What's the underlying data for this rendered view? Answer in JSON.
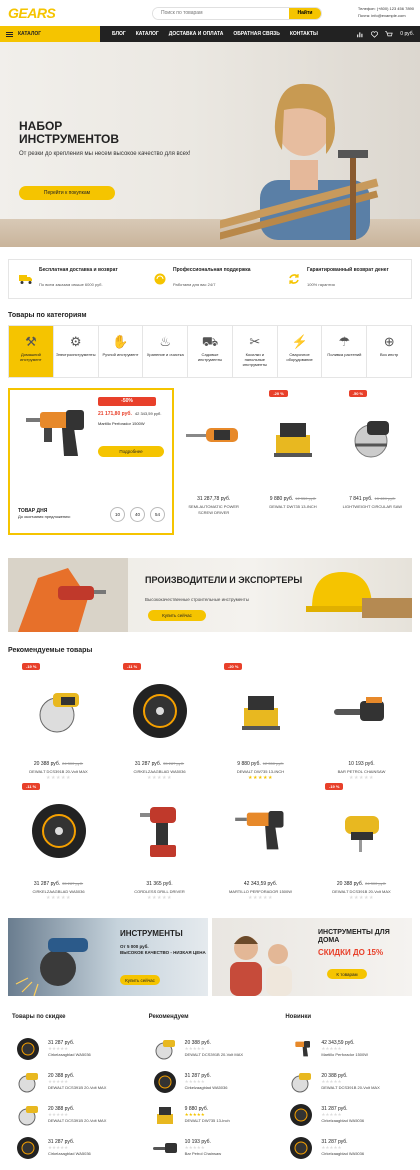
{
  "header": {
    "logo": "GEARS",
    "search_placeholder": "Поиск по товарам",
    "search_button": "Найти",
    "phone": "Телефон: (+800) 123 456 7890",
    "email": "Почта: info@example.com"
  },
  "nav": {
    "catalog": "КАТАЛОГ",
    "links": [
      "БЛОГ",
      "КАТАЛОГ",
      "ДОСТАВКА И ОПЛАТА",
      "ОБРАТНАЯ СВЯЗЬ",
      "КОНТАКТЫ"
    ],
    "cart_count": "0",
    "cart_total": "0 руб."
  },
  "hero": {
    "title": "НАБОР ИНСТРУМЕНТОВ",
    "subtitle": "От резки до крепления мы несем высокое качество для всех!",
    "button": "Перейти к покупкам"
  },
  "features": [
    {
      "title": "Бесплатная доставка и возврат",
      "text": "По всем заказам свыше 6000 руб.",
      "icon": "truck-icon"
    },
    {
      "title": "Профессиональная поддержка",
      "text": "Работаем для вас 24/7",
      "icon": "support-icon"
    },
    {
      "title": "Гарантированный возврат денег",
      "text": "100% гарантия",
      "icon": "refund-icon"
    }
  ],
  "categories_title": "Товары по категориям",
  "categories": [
    "Домашний инструмент",
    "Электроинструменты",
    "Ручной инструмент",
    "Хранение и очистка",
    "Садовые инструменты",
    "Косилки и напольные инструменты",
    "Сварочное оборудование",
    "Поливка растений",
    "Воз инстр"
  ],
  "deal": {
    "badge": "-50%",
    "price": "21 171,80 руб.",
    "old_price": "42 343,59 руб.",
    "name": "Martillo Perforador 1500W",
    "button": "Подробнее",
    "label": "ТОВАР ДНЯ",
    "sub": "До окончания предложения:",
    "timer": [
      "10",
      "40",
      "54"
    ]
  },
  "deal_products": [
    {
      "badge": "",
      "price": "31 287,78 руб.",
      "old": "",
      "name": "SEMI-AUTOMATIC POWER SCREW DRIVER"
    },
    {
      "badge": "-20 %",
      "price": "9 880 руб.",
      "old": "12 350 руб.",
      "name": "DEWALT DW735 13-INCH"
    },
    {
      "badge": "-50 %",
      "price": "7 841 руб.",
      "old": "15 424 руб.",
      "name": "LIGHTWEIGHT CIRCULAR SAW"
    }
  ],
  "banner": {
    "title": "ПРОИЗВОДИТЕЛИ И ЭКСПОРТЕРЫ",
    "text": "Высококачественные строительные инструменты",
    "button": "Купить сейчас"
  },
  "recommended_title": "Рекомендуемые товары",
  "recommended": [
    {
      "badge": "-19 %",
      "price": "20 388 руб.",
      "old": "24 300 руб.",
      "name": "DEWALT DCS391B 20-Volt MAX",
      "rated": false
    },
    {
      "badge": "-11 %",
      "price": "31 287 руб.",
      "old": "35 287 руб.",
      "name": "CIRKELZAAGBLAD WA5036",
      "rated": false
    },
    {
      "badge": "-20 %",
      "price": "9 880 руб.",
      "old": "12 350 руб.",
      "name": "DEWALT DW735 13-INCH",
      "rated": true
    },
    {
      "badge": "",
      "price": "10 193 руб.",
      "old": "",
      "name": "BAR PETROL CHAINSAW",
      "rated": false
    },
    {
      "badge": "-11 %",
      "price": "31 287 руб.",
      "old": "35 287 руб.",
      "name": "CIRKELZAAGBLAD WA5036",
      "rated": false
    },
    {
      "badge": "",
      "price": "31 365 руб.",
      "old": "",
      "name": "CORDLESS DRILL DRIVER",
      "rated": false
    },
    {
      "badge": "",
      "price": "42 343,59 руб.",
      "old": "",
      "name": "MARTILLO PERFORADOR 1500W",
      "rated": false
    },
    {
      "badge": "-19 %",
      "price": "20 388 руб.",
      "old": "24 300 руб.",
      "name": "DEWALT DCS391B 20-Volt MAX",
      "rated": false
    }
  ],
  "promo1": {
    "title": "ИНСТРУМЕНТЫ",
    "price": "От 5 000 руб.",
    "text": "ВЫСОКОЕ КАЧЕСТВО - НИЗКАЯ ЦЕНА",
    "button": "Купить сейчас"
  },
  "promo2": {
    "title": "ИНСТРУМЕНТЫ ДЛЯ ДОМА",
    "hot": "СКИДКИ ДО 15%",
    "button": "К товарам"
  },
  "lists": [
    {
      "title": "Товары по скидке",
      "items": [
        {
          "price": "31 287 руб.",
          "name": "Cirkelzaagblad WA5036",
          "rated": false
        },
        {
          "price": "20 388 руб.",
          "name": "DEWALT DCS391B 20-Volt MAX",
          "rated": false
        },
        {
          "price": "20 388 руб.",
          "name": "DEWALT DCS391B 20-Volt MAX",
          "rated": false
        },
        {
          "price": "31 287 руб.",
          "name": "Cirkelzaagblad WA5036",
          "rated": false
        }
      ]
    },
    {
      "title": "Рекомендуем",
      "items": [
        {
          "price": "20 388 руб.",
          "name": "DEWALT DCS391B 20-Volt MAX",
          "rated": false
        },
        {
          "price": "31 287 руб.",
          "name": "Cirkelzaagblad WA5036",
          "rated": false
        },
        {
          "price": "9 880 руб.",
          "name": "DEWALT DW735 13-Inch",
          "rated": true
        },
        {
          "price": "10 193 руб.",
          "name": "Bar Petrol Chainsaw",
          "rated": false
        }
      ]
    },
    {
      "title": "Новинки",
      "items": [
        {
          "price": "42 343,59 руб.",
          "name": "Martillo Perforador 1500W",
          "rated": false
        },
        {
          "price": "20 388 руб.",
          "name": "DEWALT DCS391B 20-Volt MAX",
          "rated": false
        },
        {
          "price": "31 287 руб.",
          "name": "Cirkelzaagblad WA5036",
          "rated": false
        },
        {
          "price": "31 287 руб.",
          "name": "Cirkelzaagblad WA5036",
          "rated": false
        }
      ]
    }
  ],
  "stars": "★★★★★",
  "colors": {
    "accent": "#f5c400",
    "dark": "#222222",
    "sale": "#e8402a"
  }
}
